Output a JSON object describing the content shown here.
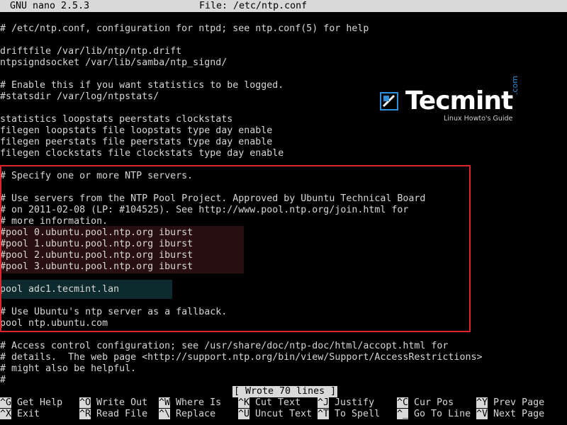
{
  "titlebar": {
    "app": "GNU nano 2.5.3",
    "file": "File: /etc/ntp.conf"
  },
  "lines": [
    "# /etc/ntp.conf, configuration for ntpd; see ntp.conf(5) for help",
    "",
    "driftfile /var/lib/ntp/ntp.drift",
    "ntpsigndsocket /var/lib/samba/ntp_signd/",
    "",
    "# Enable this if you want statistics to be logged.",
    "#statsdir /var/log/ntpstats/",
    "",
    "statistics loopstats peerstats clockstats",
    "filegen loopstats file loopstats type day enable",
    "filegen peerstats file peerstats type day enable",
    "filegen clockstats file clockstats type day enable",
    "",
    "# Specify one or more NTP servers.",
    "",
    "# Use servers from the NTP Pool Project. Approved by Ubuntu Technical Board",
    "# on 2011-02-08 (LP: #104525). See http://www.pool.ntp.org/join.html for",
    "# more information.",
    "#pool 0.ubuntu.pool.ntp.org iburst",
    "#pool 1.ubuntu.pool.ntp.org iburst",
    "#pool 2.ubuntu.pool.ntp.org iburst",
    "#pool 3.ubuntu.pool.ntp.org iburst",
    "",
    "pool adc1.tecmint.lan",
    "",
    "# Use Ubuntu's ntp server as a fallback.",
    "pool ntp.ubuntu.com",
    "",
    "# Access control configuration; see /usr/share/doc/ntp-doc/html/accopt.html for",
    "# details.  The web page <http://support.ntp.org/bin/view/Support/AccessRestrictions>",
    "# might also be helpful.",
    "#"
  ],
  "status_message": "[ Wrote 70 lines ]",
  "shortcuts": [
    {
      "key": "^G",
      "label": "Get Help"
    },
    {
      "key": "^O",
      "label": "Write Out"
    },
    {
      "key": "^W",
      "label": "Where Is"
    },
    {
      "key": "^K",
      "label": "Cut Text"
    },
    {
      "key": "^J",
      "label": "Justify"
    },
    {
      "key": "^C",
      "label": "Cur Pos"
    },
    {
      "key": "^Y",
      "label": "Prev Page"
    },
    {
      "key": "^X",
      "label": "Exit"
    },
    {
      "key": "^R",
      "label": "Read File"
    },
    {
      "key": "^\\",
      "label": "Replace"
    },
    {
      "key": "^U",
      "label": "Uncut Text"
    },
    {
      "key": "^T",
      "label": "To Spell"
    },
    {
      "key": "^_",
      "label": "Go To Line"
    },
    {
      "key": "^V",
      "label": "Next Page"
    }
  ],
  "watermark": {
    "brand": "Tecmint",
    "domain": ".com",
    "tagline": "Linux Howto's Guide"
  },
  "colors": {
    "highlight_box": "#e0242e",
    "commented_pool_bg": "#2a0f10",
    "added_pool_bg": "#0d2b2e",
    "brand_blue": "#2f8fd8"
  }
}
